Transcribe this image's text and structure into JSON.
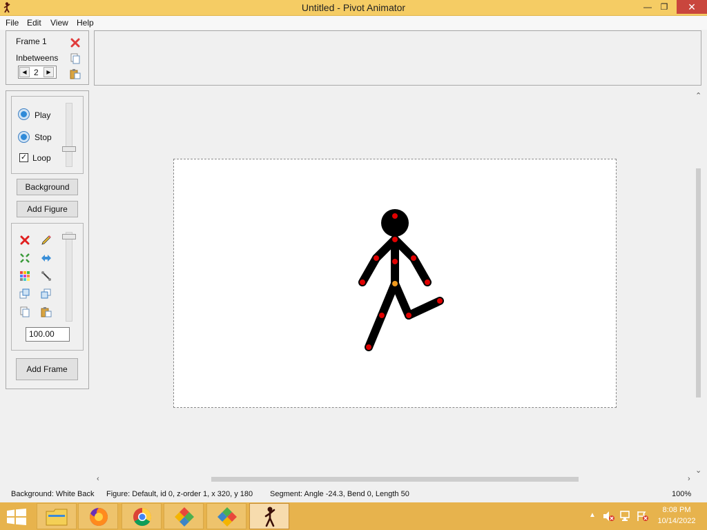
{
  "window": {
    "title": "Untitled - Pivot Animator"
  },
  "menu": [
    "File",
    "Edit",
    "View",
    "Help"
  ],
  "frame_panel": {
    "frame_label": "Frame 1",
    "inbetweens_label": "Inbetweens",
    "inbetweens_value": "2"
  },
  "playback": {
    "play": "Play",
    "stop": "Stop",
    "loop": "Loop",
    "loop_checked": true
  },
  "buttons": {
    "background": "Background",
    "add_figure": "Add Figure",
    "add_frame": "Add Frame"
  },
  "figure_tools": {
    "scale_value": "100.00"
  },
  "statusbar": {
    "background": "Background: White Back",
    "figure": "Figure: Default,  id 0,  z-order 1,  x 320, y 180",
    "segment": "Segment: Angle -24.3,  Bend 0,  Length 50",
    "zoom": "100%"
  },
  "taskbar": {
    "time": "8:08 PM",
    "date": "10/14/2022"
  },
  "colors": {
    "titlebar": "#f5cc64",
    "taskbar": "#e7b34d",
    "joint": "#e00000",
    "pivot": "#f09a1e"
  }
}
